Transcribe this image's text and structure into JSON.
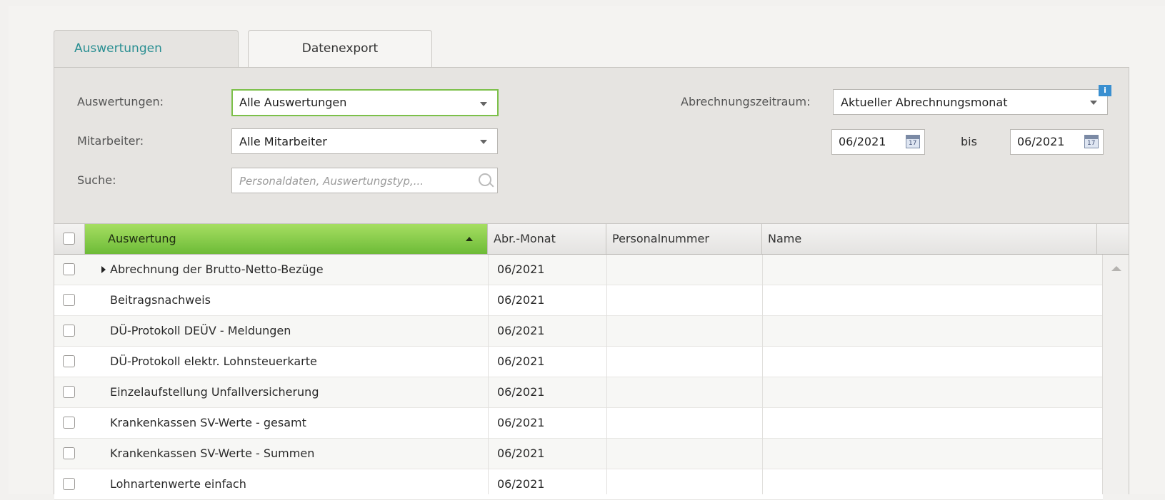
{
  "tabs": [
    {
      "label": "Auswertungen"
    },
    {
      "label": "Datenexport"
    }
  ],
  "filters": {
    "auswertungen_label": "Auswertungen:",
    "auswertungen_value": "Alle Auswertungen",
    "mitarbeiter_label": "Mitarbeiter:",
    "mitarbeiter_value": "Alle Mitarbeiter",
    "suche_label": "Suche:",
    "suche_placeholder": "Personaldaten, Auswertungstyp,...",
    "zeitraum_label": "Abrechnungszeitraum:",
    "zeitraum_value": "Aktueller Abrechnungsmonat",
    "info_badge": "i",
    "date_from": "06/2021",
    "bis_label": "bis",
    "date_to": "06/2021",
    "calendar_glyph": "17"
  },
  "table": {
    "columns": [
      "Auswertung",
      "Abr.-Monat",
      "Personalnummer",
      "Name"
    ],
    "rows": [
      {
        "auswertung": "Abrechnung der Brutto-Netto-Bezüge",
        "monat": "06/2021",
        "personalnummer": "",
        "name": ""
      },
      {
        "auswertung": "Beitragsnachweis",
        "monat": "06/2021",
        "personalnummer": "",
        "name": ""
      },
      {
        "auswertung": "DÜ-Protokoll DEÜV - Meldungen",
        "monat": "06/2021",
        "personalnummer": "",
        "name": ""
      },
      {
        "auswertung": "DÜ-Protokoll elektr. Lohnsteuerkarte",
        "monat": "06/2021",
        "personalnummer": "",
        "name": ""
      },
      {
        "auswertung": "Einzelaufstellung Unfallversicherung",
        "monat": "06/2021",
        "personalnummer": "",
        "name": ""
      },
      {
        "auswertung": "Krankenkassen SV-Werte - gesamt",
        "monat": "06/2021",
        "personalnummer": "",
        "name": ""
      },
      {
        "auswertung": "Krankenkassen SV-Werte - Summen",
        "monat": "06/2021",
        "personalnummer": "",
        "name": ""
      },
      {
        "auswertung": "Lohnartenwerte einfach",
        "monat": "06/2021",
        "personalnummer": "",
        "name": ""
      }
    ]
  },
  "colors": {
    "accent_tab": "#2a8f92",
    "sorted_header": "#6dbb37",
    "focus_border": "#7cc04a",
    "info_badge": "#3a8fd0"
  }
}
